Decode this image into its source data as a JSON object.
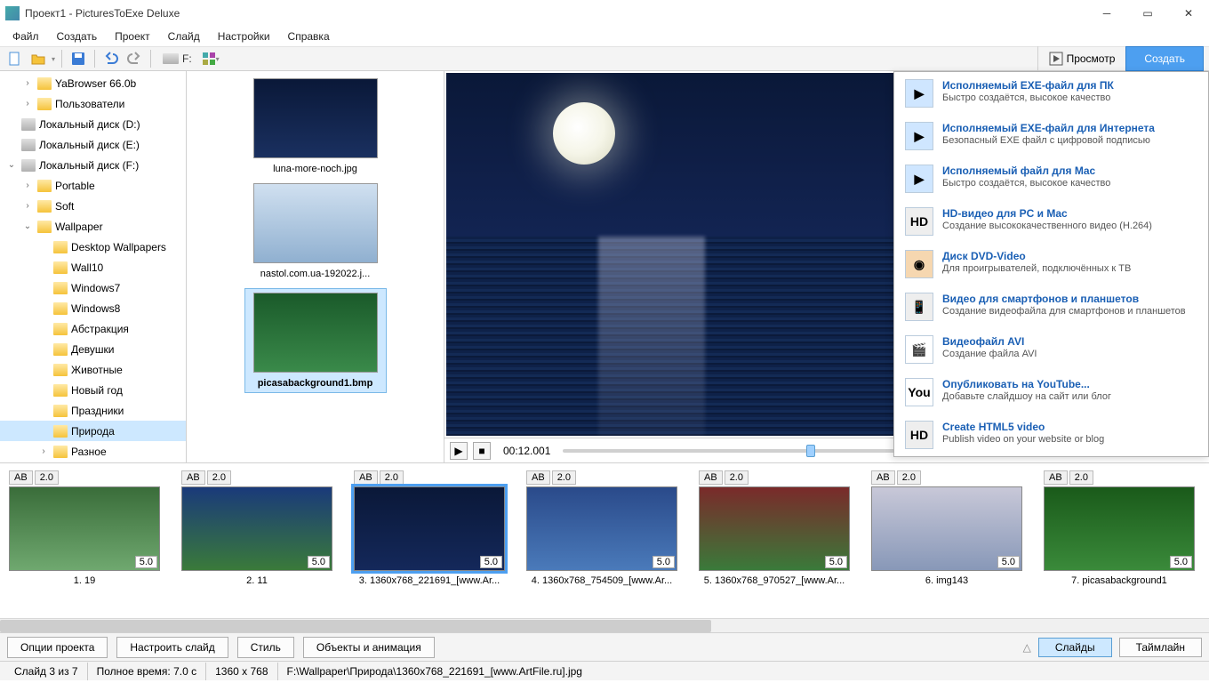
{
  "titlebar": {
    "title": "Проект1 - PicturesToExe Deluxe"
  },
  "menu": [
    "Файл",
    "Создать",
    "Проект",
    "Слайд",
    "Настройки",
    "Справка"
  ],
  "toolbar": {
    "drive": "F:",
    "preview": "Просмотр",
    "create": "Создать"
  },
  "tree": [
    {
      "indent": 1,
      "chev": "›",
      "icon": "folder",
      "label": "YaBrowser 66.0b"
    },
    {
      "indent": 1,
      "chev": "›",
      "icon": "folder",
      "label": "Пользователи"
    },
    {
      "indent": 0,
      "chev": "",
      "icon": "drive",
      "label": "Локальный диск (D:)"
    },
    {
      "indent": 0,
      "chev": "",
      "icon": "drive",
      "label": "Локальный диск (E:)"
    },
    {
      "indent": 0,
      "chev": "⌄",
      "icon": "drive",
      "label": "Локальный диск (F:)"
    },
    {
      "indent": 1,
      "chev": "›",
      "icon": "folder",
      "label": "Portable"
    },
    {
      "indent": 1,
      "chev": "›",
      "icon": "folder",
      "label": "Soft"
    },
    {
      "indent": 1,
      "chev": "⌄",
      "icon": "folder",
      "label": "Wallpaper"
    },
    {
      "indent": 2,
      "chev": "",
      "icon": "folder",
      "label": "Desktop Wallpapers"
    },
    {
      "indent": 2,
      "chev": "",
      "icon": "folder",
      "label": "Wall10"
    },
    {
      "indent": 2,
      "chev": "",
      "icon": "folder",
      "label": "Windows7"
    },
    {
      "indent": 2,
      "chev": "",
      "icon": "folder",
      "label": "Windows8"
    },
    {
      "indent": 2,
      "chev": "",
      "icon": "folder",
      "label": "Абстракция"
    },
    {
      "indent": 2,
      "chev": "",
      "icon": "folder",
      "label": "Девушки"
    },
    {
      "indent": 2,
      "chev": "",
      "icon": "folder",
      "label": "Животные"
    },
    {
      "indent": 2,
      "chev": "",
      "icon": "folder",
      "label": "Новый год"
    },
    {
      "indent": 2,
      "chev": "",
      "icon": "folder",
      "label": "Праздники"
    },
    {
      "indent": 2,
      "chev": "",
      "icon": "folder",
      "label": "Природа",
      "sel": true
    },
    {
      "indent": 2,
      "chev": "›",
      "icon": "folder",
      "label": "Разное"
    }
  ],
  "thumbs": [
    {
      "cls": "gnight",
      "label": "luna-more-noch.jpg"
    },
    {
      "cls": "gwinter",
      "label": "nastol.com.ua-192022.j..."
    },
    {
      "cls": "gforest",
      "label": "picasabackground1.bmp",
      "sel": true
    }
  ],
  "playback": {
    "time": "00:12.001"
  },
  "slides": [
    {
      "ab": "AB",
      "t": "2.0",
      "dur": "5.0",
      "cls": "g1",
      "cap": "1. 19"
    },
    {
      "ab": "AB",
      "t": "2.0",
      "dur": "5.0",
      "cls": "g2",
      "cap": "2. 11"
    },
    {
      "ab": "AB",
      "t": "2.0",
      "dur": "5.0",
      "cls": "g3",
      "cap": "3. 1360x768_221691_[www.Ar...",
      "sel": true
    },
    {
      "ab": "AB",
      "t": "2.0",
      "dur": "5.0",
      "cls": "g4",
      "cap": "4. 1360x768_754509_[www.Ar..."
    },
    {
      "ab": "AB",
      "t": "2.0",
      "dur": "5.0",
      "cls": "g5",
      "cap": "5. 1360x768_970527_[www.Ar..."
    },
    {
      "ab": "AB",
      "t": "2.0",
      "dur": "5.0",
      "cls": "g6",
      "cap": "6. img143"
    },
    {
      "ab": "AB",
      "t": "2.0",
      "dur": "5.0",
      "cls": "g7",
      "cap": "7. picasabackground1"
    }
  ],
  "bottom": {
    "b1": "Опции проекта",
    "b2": "Настроить слайд",
    "b3": "Стиль",
    "b4": "Объекты и анимация",
    "tab1": "Слайды",
    "tab2": "Таймлайн"
  },
  "status": {
    "s1": "Слайд 3 из 7",
    "s2": "Полное время: 7.0 с",
    "s3": "1360 x 768",
    "s4": "F:\\Wallpaper\\Природа\\1360x768_221691_[www.ArtFile.ru].jpg"
  },
  "publish": [
    {
      "icon": "▶",
      "bg": "#cfe6ff",
      "title": "Исполняемый EXE-файл для ПК",
      "desc": "Быстро создаётся, высокое качество"
    },
    {
      "icon": "▶",
      "bg": "#cfe6ff",
      "title": "Исполняемый EXE-файл для Интернета",
      "desc": "Безопасный EXE файл с цифровой подписью"
    },
    {
      "icon": "▶",
      "bg": "#cfe6ff",
      "title": "Исполняемый файл для Mac",
      "desc": "Быстро создаётся, высокое качество"
    },
    {
      "icon": "HD",
      "bg": "#eee",
      "title": "HD-видео для PC и Mac",
      "desc": "Создание высококачественного видео (H.264)"
    },
    {
      "icon": "◉",
      "bg": "#f6d7b0",
      "title": "Диск DVD-Video",
      "desc": "Для проигрывателей, подключённых к ТВ"
    },
    {
      "icon": "📱",
      "bg": "#eee",
      "title": "Видео для смартфонов и планшетов",
      "desc": "Создание видеофайла для смартфонов и планшетов"
    },
    {
      "icon": "🎬",
      "bg": "#fff",
      "title": "Видеофайл AVI",
      "desc": "Создание файла AVI"
    },
    {
      "icon": "You",
      "bg": "#fff",
      "title": "Опубликовать на YouTube...",
      "desc": "Добавьте слайдшоу на сайт или блог"
    },
    {
      "icon": "HD",
      "bg": "#eee",
      "title": "Create HTML5 video",
      "desc": "Publish video on your website or blog"
    }
  ]
}
